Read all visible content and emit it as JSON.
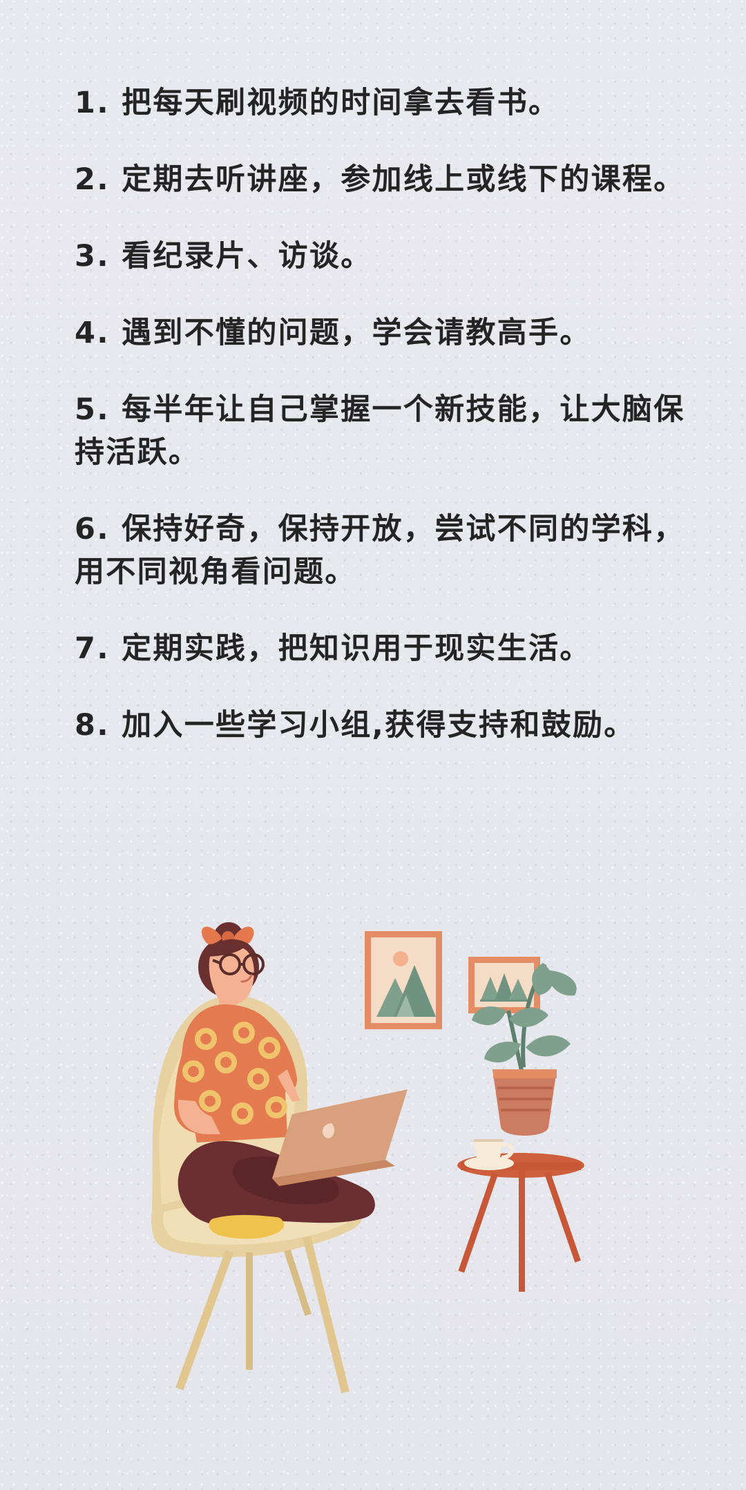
{
  "tips": [
    {
      "text": "1. 把每天刷视频的时间拿去看书。"
    },
    {
      "text": "2. 定期去听讲座，参加线上或线下的课程。"
    },
    {
      "text": "3. 看纪录片、访谈。"
    },
    {
      "text": "4. 遇到不懂的问题，学会请教高手。"
    },
    {
      "text": "5. 每半年让自己掌握一个新技能，让大脑保持活跃。"
    },
    {
      "text": "6. 保持好奇，保持开放，尝试不同的学科，用不同视角看问题。"
    },
    {
      "text": "7. 定期实践，把知识用于现实生活。"
    },
    {
      "text": "8. 加入一些学习小组,获得支持和鼓励。"
    }
  ],
  "illustration": {
    "subject": "woman with glasses sitting in armchair using laptop, framed pictures on wall, side table with cup and potted plant",
    "colors": {
      "background": "#e7e8ee",
      "chair": "#e7d1a1",
      "chair_shadow": "#d7bd84",
      "top": "#e37a50",
      "pattern": "#f0c46d",
      "pants": "#6b2f31",
      "laptop": "#d9a07d",
      "skin": "#f4b293",
      "hair": "#6a2f2f",
      "bow": "#e6784d",
      "frame": "#e48d64",
      "mountain": "#7ea08d",
      "table": "#cf5f3c",
      "plant": "#7ea08d",
      "pot": "#cc7c60",
      "cup": "#f6ead9"
    }
  }
}
